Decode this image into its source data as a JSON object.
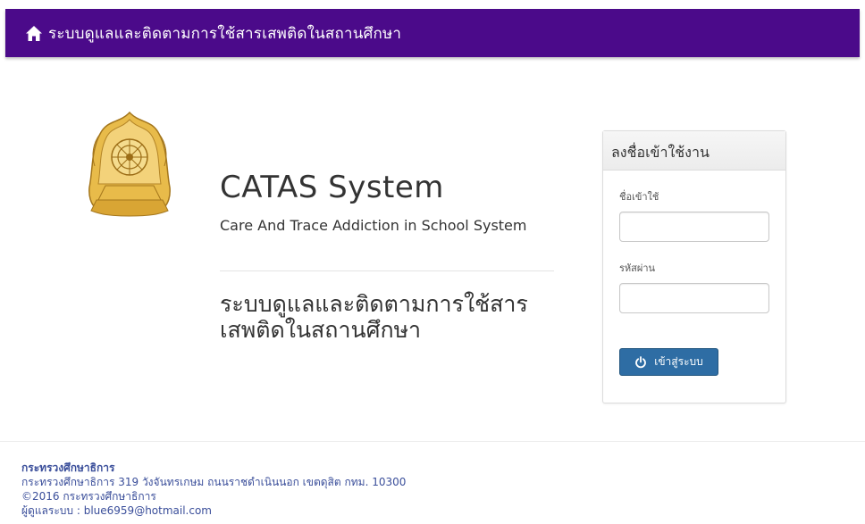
{
  "navbar": {
    "title": "ระบบดูแลและติดตามการใช้สารเสพติดในสถานศึกษา",
    "icon": "home-icon"
  },
  "hero": {
    "title": "CATAS System",
    "subtitle": "Care And Trace Addiction in School System",
    "thai_title": "ระบบดูแลและติดตามการใช้สารเสพติดในสถานศึกษา"
  },
  "login": {
    "heading": "ลงชื่อเข้าใช้งาน",
    "username_label": "ชื่อเข้าใช้",
    "username_value": "",
    "password_label": "รหัสผ่าน",
    "password_value": "",
    "button_label": "เข้าสู่ระบบ",
    "button_icon": "power-icon"
  },
  "footer": {
    "org": "กระทรวงศึกษาธิการ",
    "address": "กระทรวงศึกษาธิการ 319 วังจันทรเกษม ถนนราชดำเนินนอก เขตดุสิต กทม. 10300",
    "copyright": "©2016 กระทรวงศึกษาธิการ",
    "admin": "ผู้ดูแลระบบ : blue6959@hotmail.com"
  },
  "colors": {
    "navbar": "#4b0a8a",
    "button": "#2e6da4",
    "footer_text": "#3a4e9a",
    "emblem_gold": "#e0b240"
  }
}
